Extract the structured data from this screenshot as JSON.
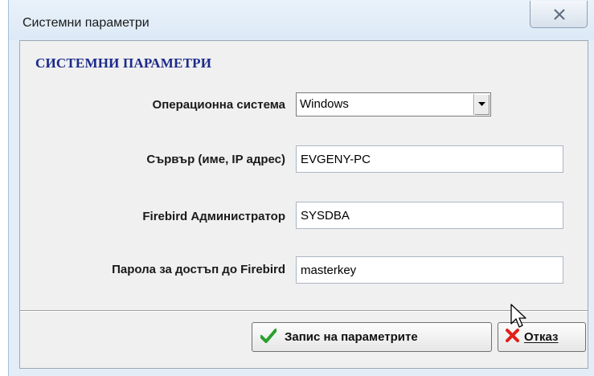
{
  "window": {
    "title": "Системни параметри",
    "close_icon": "close-icon"
  },
  "panel": {
    "heading": "СИСТЕМНИ ПАРАМЕТРИ"
  },
  "fields": {
    "os": {
      "label": "Операционна система",
      "value": "Windows"
    },
    "server": {
      "label": "Сървър (име, IP адрес)",
      "value": "EVGENY-PC"
    },
    "admin": {
      "label": "Firebird Администратор",
      "value": "SYSDBA"
    },
    "password": {
      "label": "Парола за достъп до Firebird",
      "value": "masterkey"
    }
  },
  "buttons": {
    "save_label": "Запис на параметрите",
    "save_icon": "checkmark-icon",
    "cancel_label": "Отказ",
    "cancel_icon": "x-icon"
  },
  "colors": {
    "heading": "#1a2a8a",
    "check": "#2aa02a",
    "cancel": "#e0201a"
  }
}
